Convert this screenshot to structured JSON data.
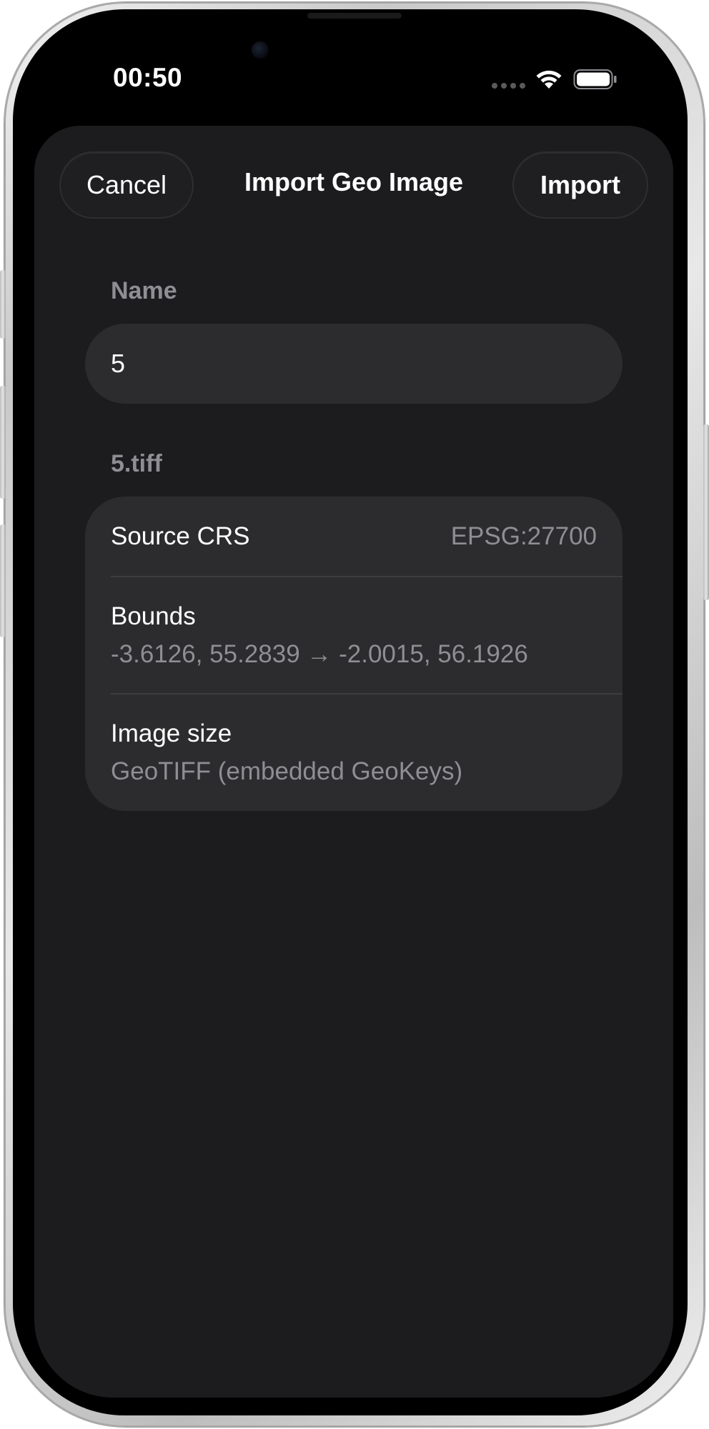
{
  "status_bar": {
    "time": "00:50",
    "icons": [
      "cellular-dots-icon",
      "wifi-icon",
      "battery-icon"
    ]
  },
  "nav": {
    "cancel_label": "Cancel",
    "title": "Import Geo Image",
    "import_label": "Import"
  },
  "name_section": {
    "header": "Name",
    "value": "5"
  },
  "file_section": {
    "header": "5.tiff",
    "rows": [
      {
        "label": "Source CRS",
        "value": "EPSG:27700"
      },
      {
        "label": "Bounds",
        "value": "-3.6126, 55.2839 → -2.0015, 56.1926"
      },
      {
        "label": "Image size",
        "value": "GeoTIFF (embedded GeoKeys)"
      }
    ]
  },
  "colors": {
    "sheet_background": "#1c1c1e",
    "card_background": "#2c2c2e",
    "secondary_text": "#8e8e93",
    "primary_text": "#ffffff"
  }
}
